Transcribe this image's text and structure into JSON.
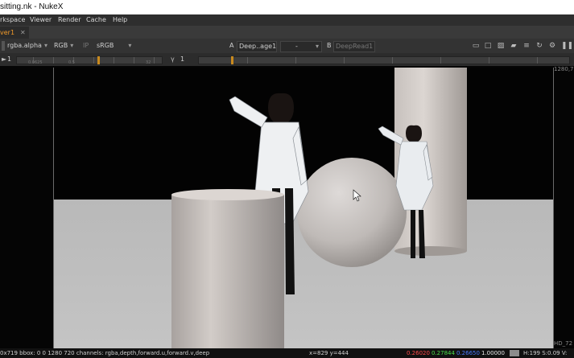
{
  "window": {
    "title": "sitting.nk - NukeX"
  },
  "menu": {
    "items": [
      "rkspace",
      "Viewer",
      "Render",
      "Cache",
      "Help"
    ]
  },
  "viewer_tab": {
    "label": "ver1",
    "close": "✕"
  },
  "toolbar": {
    "channels": "rgba.alpha",
    "colorspace_mode": "RGB",
    "ip_label": "IP",
    "lut": "sRGB",
    "input_a_letter": "A",
    "input_a": "Deep..age1",
    "operation": "-",
    "input_b_letter": "B",
    "input_b": "DeepRead1",
    "gain_value": "1",
    "gamma_label": "γ",
    "gamma_value": "1",
    "slider_scale": [
      "0.0625",
      "0.5",
      "1",
      "2",
      "4",
      "8",
      "16",
      "32"
    ]
  },
  "viewer": {
    "top_right_label": "1280,7",
    "bottom_right_label": "HD_72"
  },
  "status": {
    "info": "0x719  bbox: 0 0 1280 720 channels: rgba,depth,forward.u,forward.v,deep",
    "coords": "x=829 y=444",
    "r": "0.26020",
    "g": "0.27844",
    "b": "0.26650",
    "a": "1.00000",
    "hsv": "H:199 S:0.09 V:"
  },
  "colors": {
    "accent": "#f09a2a",
    "r_text": "#ff4b4b",
    "g_text": "#4ade4a",
    "b_text": "#4a7bff"
  }
}
